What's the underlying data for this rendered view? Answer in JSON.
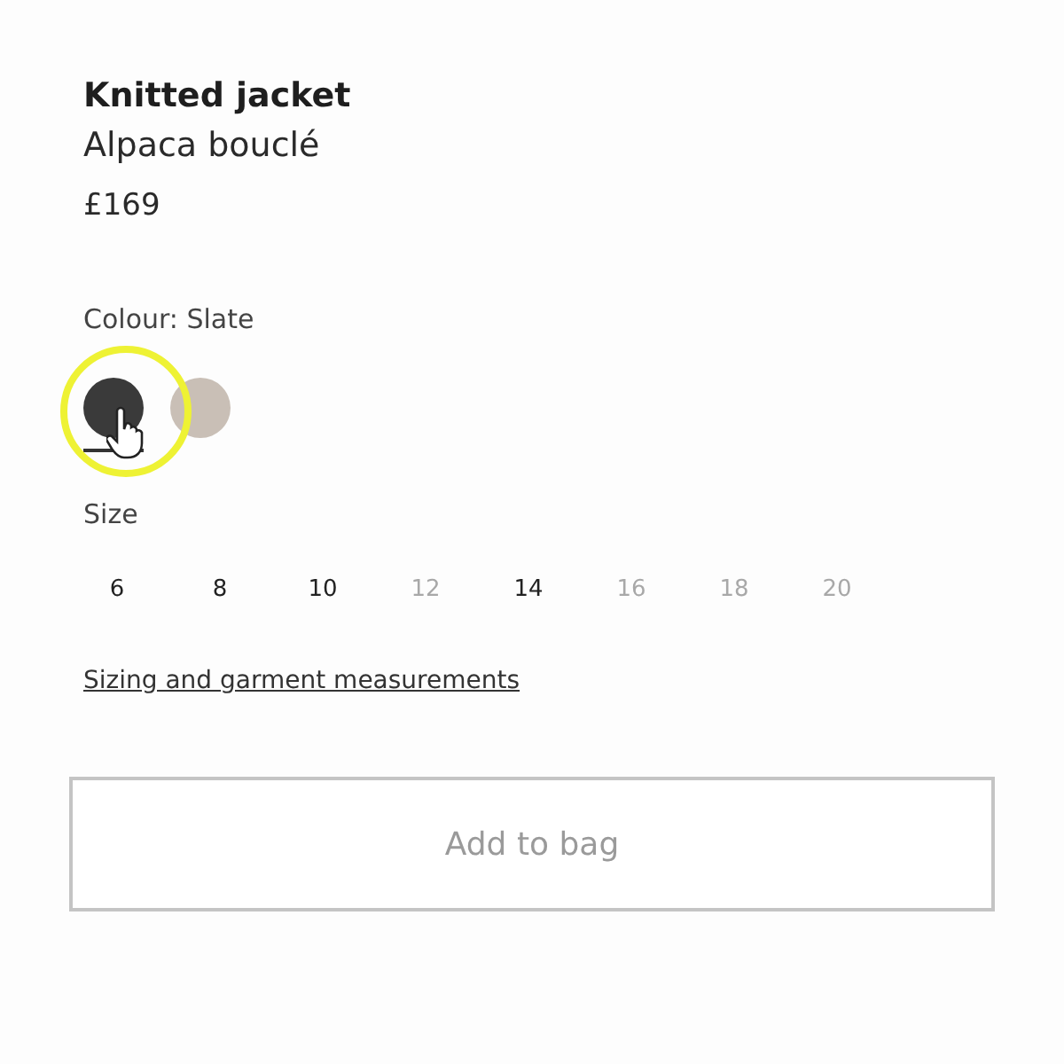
{
  "product": {
    "name": "Knitted jacket",
    "material": "Alpaca bouclé",
    "price": "£169"
  },
  "colour": {
    "label": "Colour: Slate",
    "swatches": [
      {
        "color": "#3a3a3a",
        "selected": true
      },
      {
        "color": "#c9bfb6",
        "selected": false
      }
    ]
  },
  "size": {
    "label": "Size",
    "options": [
      {
        "label": "6",
        "disabled": false
      },
      {
        "label": "8",
        "disabled": false
      },
      {
        "label": "10",
        "disabled": false
      },
      {
        "label": "12",
        "disabled": true
      },
      {
        "label": "14",
        "disabled": false
      },
      {
        "label": "16",
        "disabled": true
      },
      {
        "label": "18",
        "disabled": true
      },
      {
        "label": "20",
        "disabled": true
      }
    ]
  },
  "sizing_link": "Sizing and garment measurements",
  "add_button": {
    "label": "Add to bag",
    "disabled": true
  }
}
